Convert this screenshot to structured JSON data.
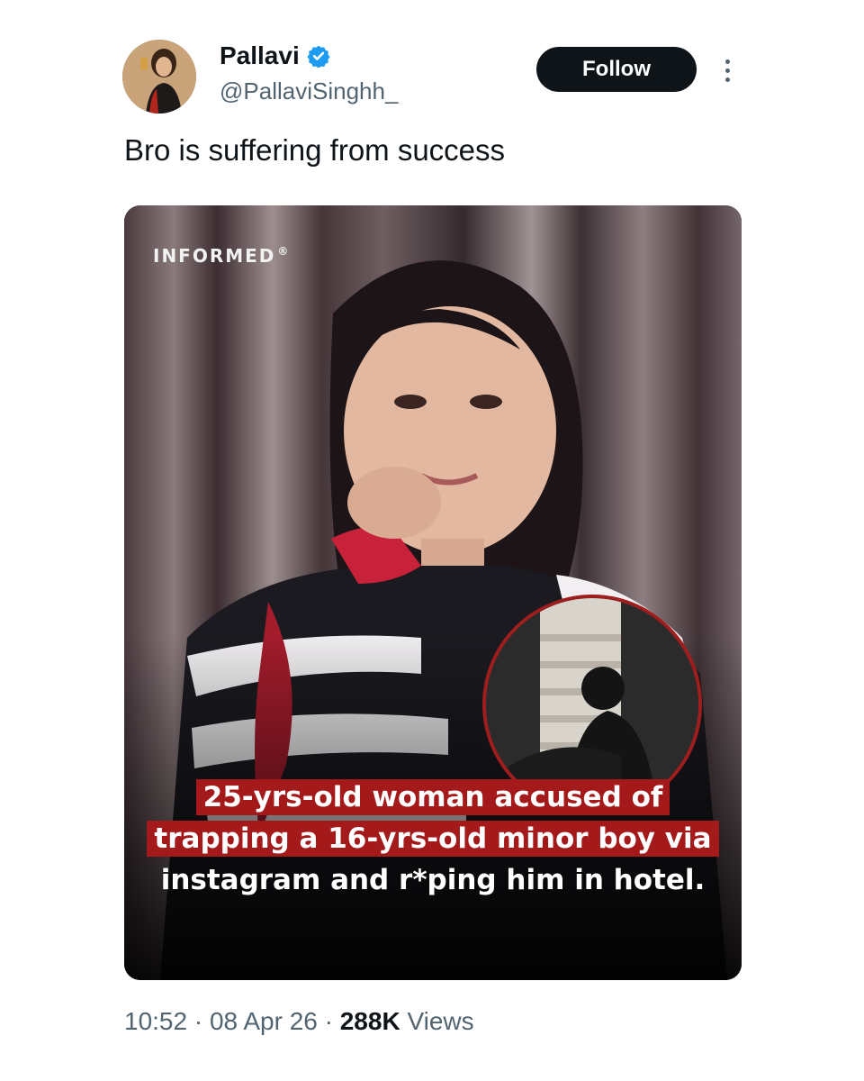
{
  "author": {
    "name": "Pallavi",
    "handle": "@PallaviSinghh_",
    "verified_color": "#1d9bf0"
  },
  "follow_label": "Follow",
  "tweet": {
    "text": "Bro is suffering from success"
  },
  "media": {
    "logo": "INFORMED",
    "logo_mark": "®",
    "caption": [
      "25-yrs-old woman accused of",
      "trapping a 16-yrs-old minor boy via",
      "instagram and r*ping him in hotel."
    ],
    "caption_highlight_color": "#a4191a"
  },
  "meta": {
    "time": "10:52",
    "sep1": " · ",
    "date": "08 Apr 26",
    "sep2": " · ",
    "views_count": "288K",
    "views_label": " Views"
  }
}
